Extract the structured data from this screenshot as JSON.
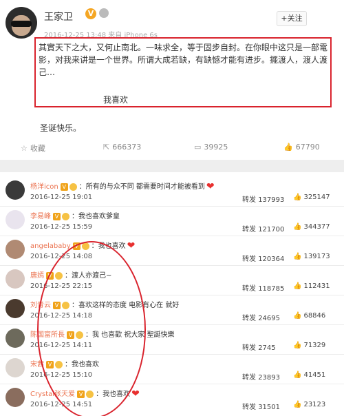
{
  "post": {
    "author": "王家卫",
    "verified_badge": "V",
    "meta": "2016-12-25 13:48 来自 iPhone 6s",
    "follow_label": "+关注",
    "text": "其實天下之大，又何止南北。一味求全，等于固步自封。在你眼中这只是一部電影，对我来讲是一个世界。所谓大成若缺，有缺憾才能有进步。擺渡人，渡人渡己…",
    "like_line": "我喜欢",
    "holiday": "圣诞快乐。"
  },
  "actions": {
    "favorite": "收藏",
    "repost": "666373",
    "comment": "39925",
    "like": "67790"
  },
  "comments": [
    {
      "name": "杨洋icon",
      "text": "所有的与众不同 都需要时间才能被看到",
      "heart": true,
      "date": "2016-12-25 19:01",
      "reposts": "137993",
      "likes": "325147",
      "avatar_color": "#3a3a3a"
    },
    {
      "name": "李易峰",
      "text": "我也喜欢爹皇",
      "heart": false,
      "date": "2016-12-25 15:59",
      "reposts": "121700",
      "likes": "344377",
      "avatar_color": "#e9e4ee"
    },
    {
      "name": "angelababy",
      "text": "我也喜欢",
      "heart": true,
      "date": "2016-12-25 14:08",
      "reposts": "120364",
      "likes": "139173",
      "avatar_color": "#b08a73"
    },
    {
      "name": "唐嫣",
      "text": "渡人亦渡己~",
      "heart": false,
      "date": "2016-12-25 22:15",
      "reposts": "118785",
      "likes": "112431",
      "avatar_color": "#d8c7c0"
    },
    {
      "name": "刘青云",
      "text": "喜欢这样的态度 电影有心在 就好",
      "heart": false,
      "date": "2016-12-25 14:18",
      "reposts": "24695",
      "likes": "68846",
      "avatar_color": "#4a3a2e"
    },
    {
      "name": "陈国富所長",
      "text": "我 也喜歡 祝大家 聖誕快樂",
      "heart": false,
      "date": "2016-12-25 14:11",
      "reposts": "2745",
      "likes": "71329",
      "avatar_color": "#6d6a5c"
    },
    {
      "name": "宋茜",
      "text": "我也喜欢",
      "heart": false,
      "date": "2016-12-25 15:10",
      "reposts": "23893",
      "likes": "41451",
      "avatar_color": "#ddd6d0"
    },
    {
      "name": "Crystal张天爱",
      "text": "我也喜欢",
      "heart": true,
      "date": "2016-12-25 14:51",
      "reposts": "31501",
      "likes": "23123",
      "avatar_color": "#8a6d5e"
    }
  ],
  "repost_label": "转发",
  "colors": {
    "accent_red": "#d9232d",
    "name_orange": "#eb7350",
    "vip_orange": "#f0a31a"
  }
}
